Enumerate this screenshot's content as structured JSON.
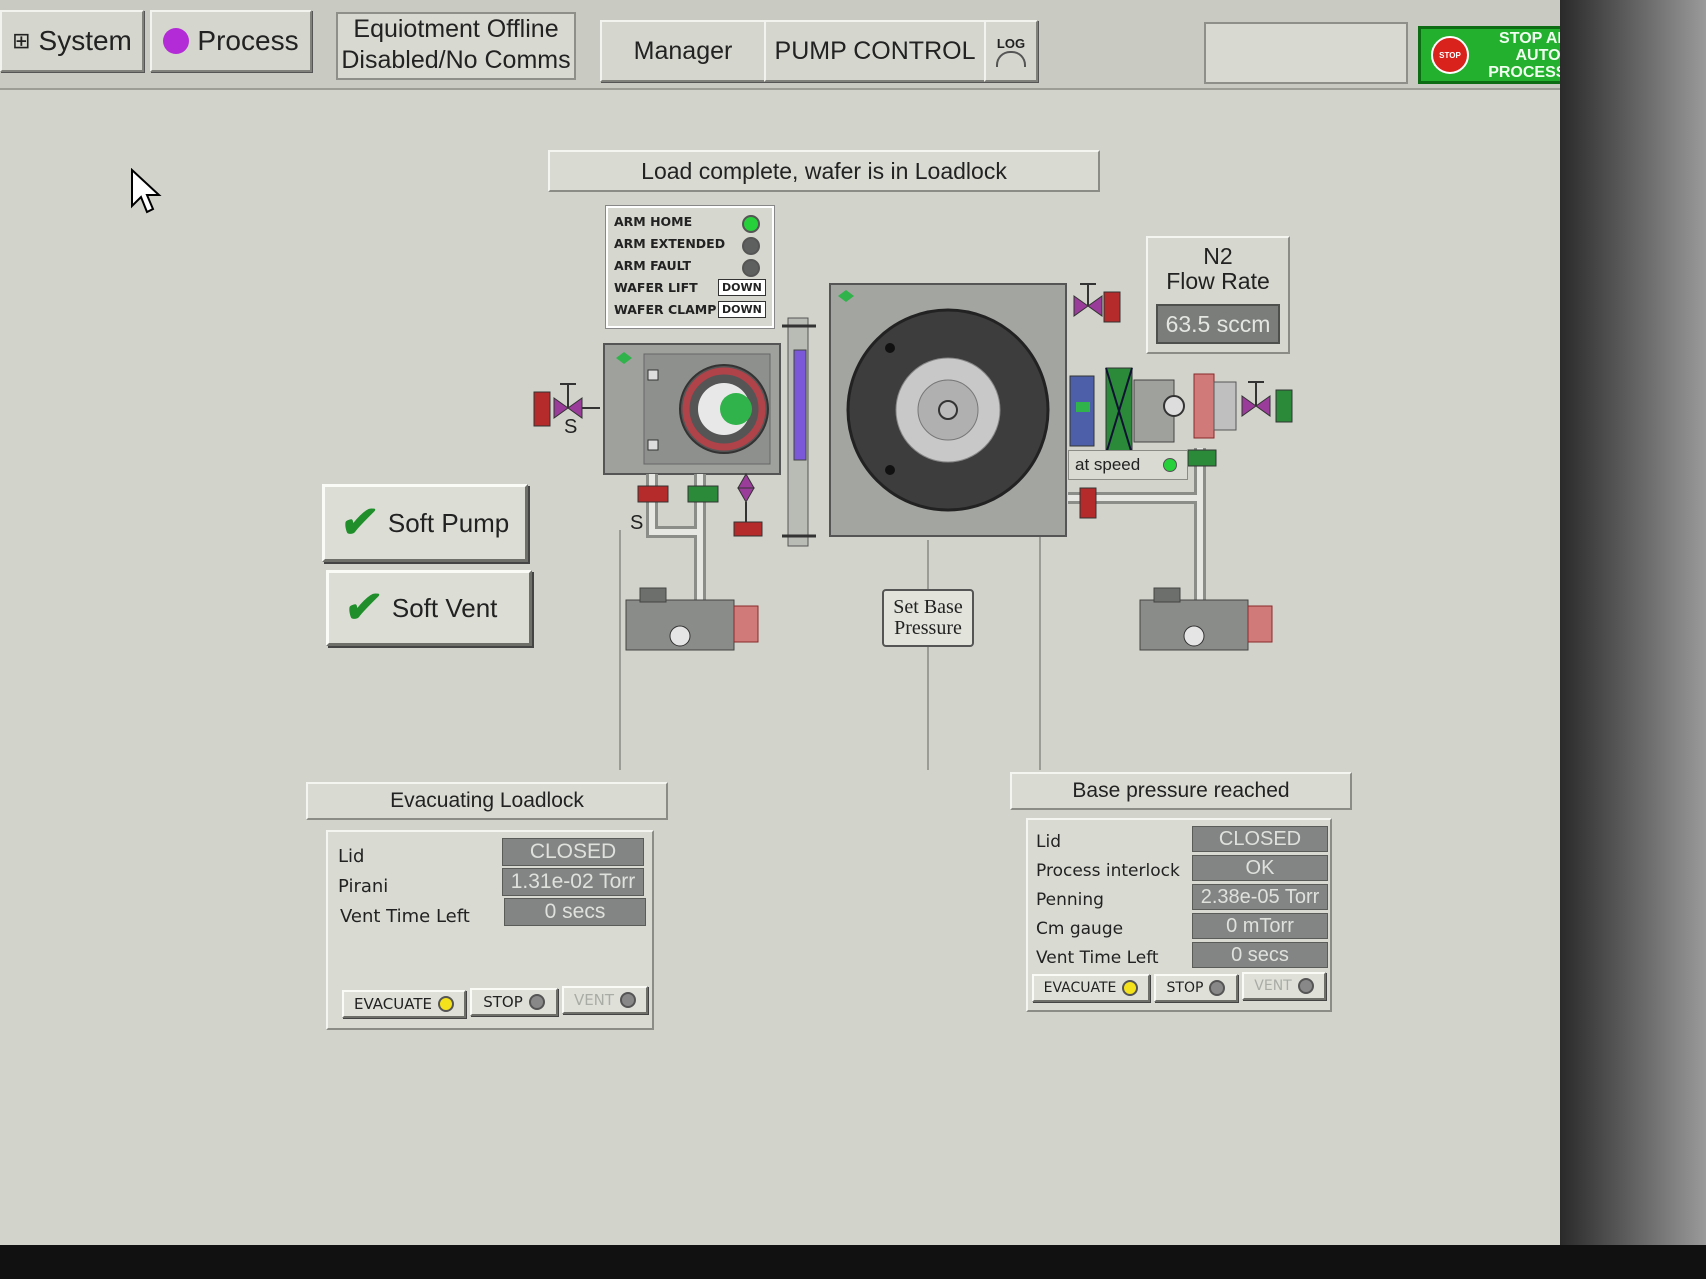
{
  "topbar": {
    "system_label": "System",
    "process_label": "Process",
    "status_line1": "Equiotment Offline",
    "status_line2": "Disabled/No Comms",
    "manager_label": "Manager",
    "pump_control_label": "PUMP CONTROL",
    "log_label": "LOG",
    "stop_icon_text": "STOP",
    "stop_all_line1": "STOP ALL AUTO",
    "stop_all_line2": "PROCESSES"
  },
  "status_message": "Load complete, wafer is in Loadlock",
  "arm_status": {
    "arm_home": "ARM HOME",
    "arm_extended": "ARM EXTENDED",
    "arm_fault": "ARM FAULT",
    "wafer_lift": "WAFER LIFT",
    "wafer_lift_value": "DOWN",
    "wafer_clamp": "WAFER CLAMP",
    "wafer_clamp_value": "DOWN"
  },
  "n2": {
    "title_line1": "N2",
    "title_line2": "Flow Rate",
    "value": "63.5 sccm"
  },
  "diagram": {
    "valve_s_left": "S",
    "valve_s_bottom": "S",
    "at_speed": "at speed",
    "set_base_line1": "Set Base",
    "set_base_line2": "Pressure"
  },
  "controls": {
    "soft_pump": "Soft Pump",
    "soft_vent": "Soft Vent"
  },
  "loadlock": {
    "title": "Evacuating Loadlock",
    "rows": [
      {
        "label": "Lid",
        "value": "CLOSED"
      },
      {
        "label": "Pirani",
        "value": "1.31e-02 Torr"
      },
      {
        "label": "Vent Time Left",
        "value": "0 secs"
      }
    ],
    "evacuate": "EVACUATE",
    "stop": "STOP",
    "vent": "VENT"
  },
  "chamber": {
    "title": "Base pressure reached",
    "rows": [
      {
        "label": "Lid",
        "value": "CLOSED"
      },
      {
        "label": "Process interlock",
        "value": "OK"
      },
      {
        "label": "Penning",
        "value": "2.38e-05 Torr"
      },
      {
        "label": "Cm gauge",
        "value": "0 mTorr"
      },
      {
        "label": "Vent Time Left",
        "value": "0 secs"
      }
    ],
    "evacuate": "EVACUATE",
    "stop": "STOP",
    "vent": "VENT"
  },
  "colors": {
    "screen_bg": "#d2d4cb",
    "stop_green": "#22b02e",
    "led_green": "#25d03a",
    "valve_red": "#b52a2a",
    "valve_green": "#2a8a3a",
    "valve_purple": "#9a3c9a"
  }
}
